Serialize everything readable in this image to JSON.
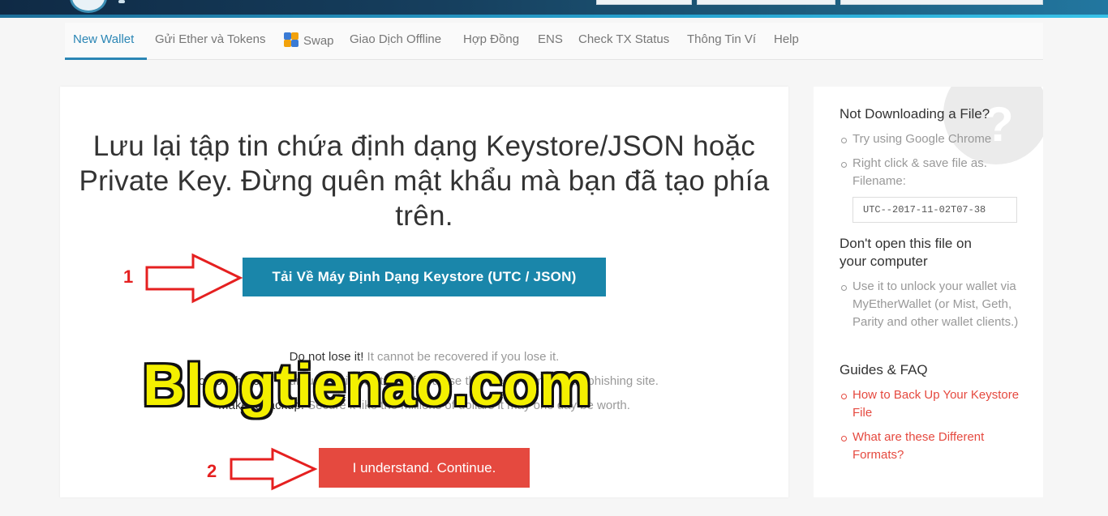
{
  "nav": {
    "items": [
      "New Wallet",
      "Gửi Ether và Tokens",
      "Swap",
      "Giao Dịch Offline",
      "Hợp Đồng",
      "ENS",
      "Check TX Status",
      "Thông Tin Ví",
      "Help"
    ]
  },
  "main": {
    "title_line1": "Lưu lại tập tin chứa định dạng Keystore/JSON hoặc",
    "title_line2": "Private Key. Đừng quên mật khẩu mà bạn đã tạo phía",
    "title_line3": "trên.",
    "download_button": "Tải Về Máy Định Dạng Keystore (UTC / JSON)",
    "warn1_bold": "Do not lose it!",
    "warn1_text": " It cannot be recovered if you lose it.",
    "warn2_bold": "Do not share it!",
    "warn2_text": " Your funds will be stolen if you use this file on a malicious/phishing site.",
    "warn3_bold": "Make a backup!",
    "warn3_text": " Secure it like the millions of dollars it may one day be worth.",
    "continue_button": "I understand. Continue."
  },
  "annotations": {
    "step1": "1",
    "step2": "2",
    "watermark": "Blogtienao.com"
  },
  "sidebar": {
    "h1": "Not Downloading a File?",
    "li1": "Try using Google Chrome",
    "li2a": "Right click & save file as.",
    "li2b": "Filename:",
    "filename": "UTC--2017-11-02T07-38",
    "h2a": "Don't open this file on",
    "h2b": "your computer",
    "li3": "Use it to unlock your wallet via MyEtherWallet (or Mist, Geth, Parity and other wallet clients.)",
    "h3": "Guides & FAQ",
    "link1": "How to Back Up Your Keystore File",
    "link2": "What are these Different Formats?"
  },
  "colors": {
    "accent_blue": "#1a86aa",
    "nav_active": "#2b86b5",
    "danger_red": "#e5493f",
    "annotation_red": "#e52020",
    "watermark_yellow": "#f4f000"
  }
}
